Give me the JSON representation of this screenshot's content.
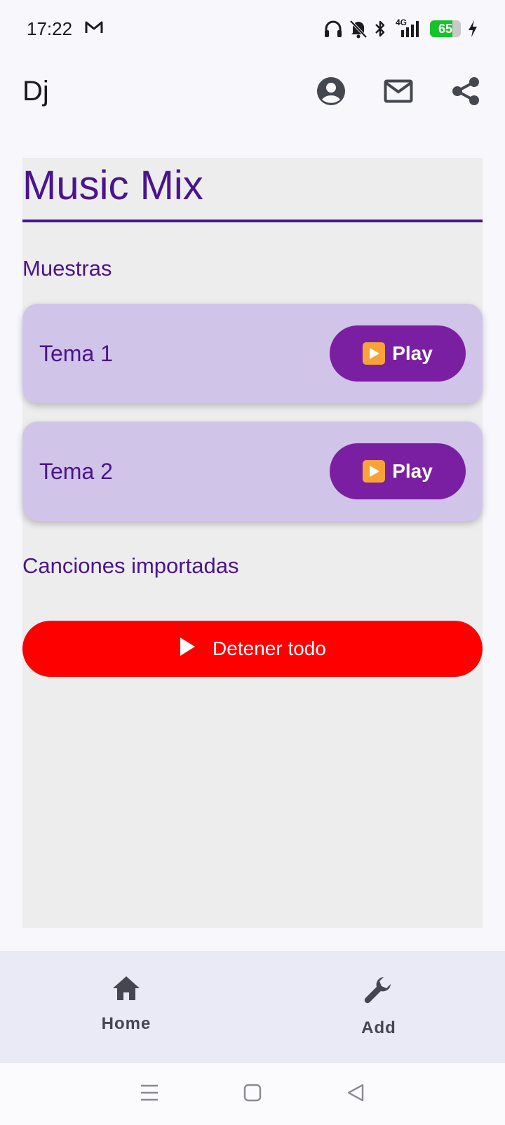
{
  "status_bar": {
    "time": "17:22",
    "network": "4G",
    "battery": "65",
    "icons": [
      "gmail-icon",
      "headphones-icon",
      "mute-icon",
      "bluetooth-icon",
      "signal-icon",
      "battery-icon",
      "charging-icon"
    ]
  },
  "app_bar": {
    "title": "Dj",
    "actions": [
      "account-icon",
      "mail-icon",
      "share-icon"
    ]
  },
  "main": {
    "title": "Music Mix",
    "samples_label": "Muestras",
    "tracks": [
      {
        "name": "Tema 1",
        "button": "Play"
      },
      {
        "name": "Tema 2",
        "button": "Play"
      }
    ],
    "imported_label": "Canciones importadas",
    "stop_all": "Detener todo"
  },
  "bottom_nav": {
    "items": [
      {
        "label": "Home",
        "icon": "home-icon"
      },
      {
        "label": "Add",
        "icon": "wrench-icon"
      }
    ]
  },
  "colors": {
    "primary": "#4a148c",
    "play_button": "#7b1fa2",
    "card": "#d1c4e9",
    "stop_button": "#ff0000",
    "battery_fill": "#17c22b"
  }
}
